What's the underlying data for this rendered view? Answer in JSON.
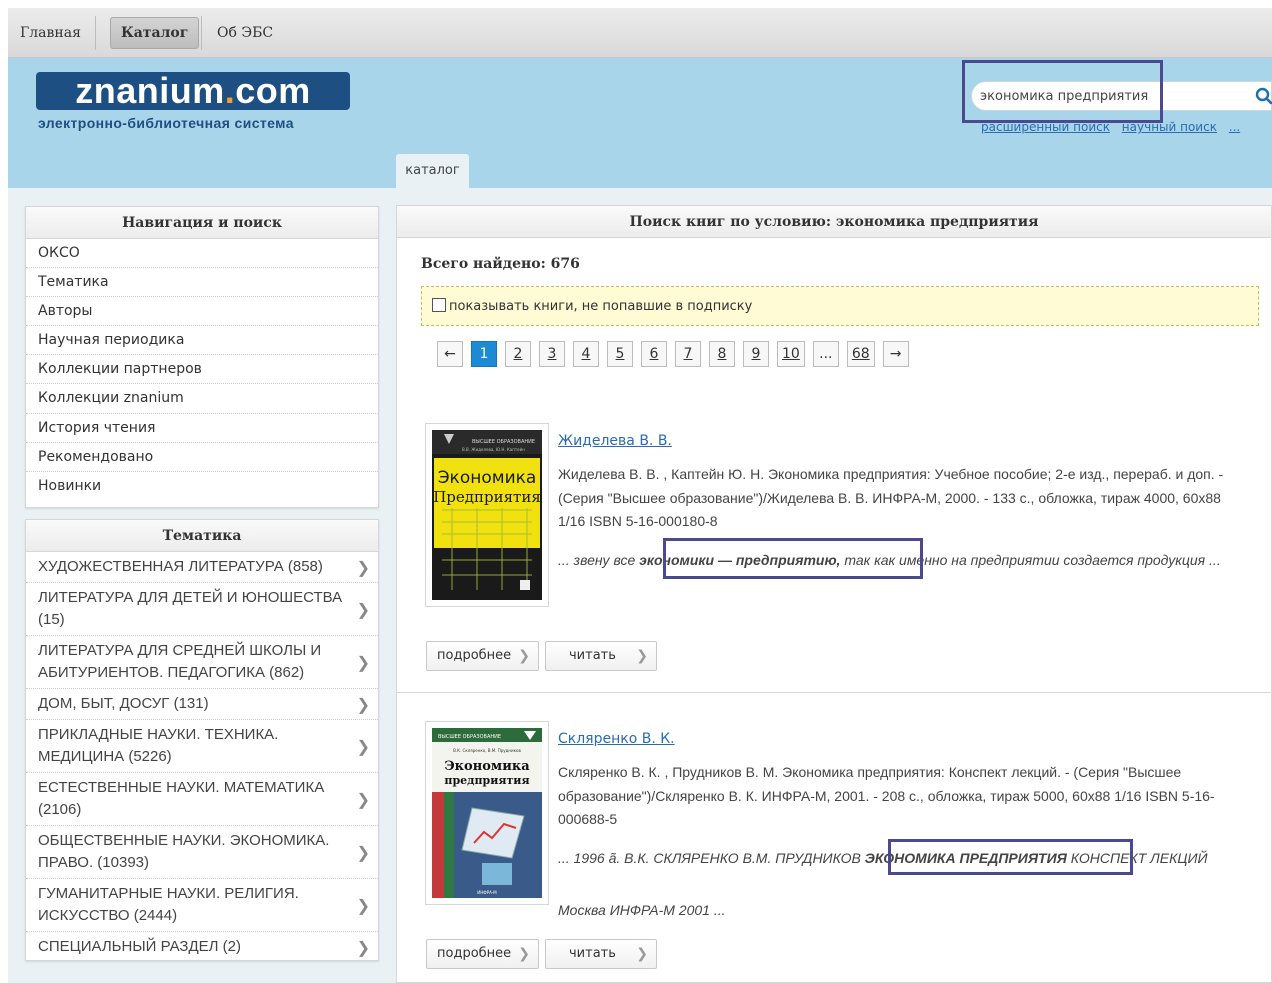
{
  "topnav": {
    "items": [
      "Главная",
      "Каталог",
      "Об ЭБС"
    ],
    "active": 1
  },
  "logo": {
    "main_a": "znanium",
    "dot": ".",
    "main_b": "com",
    "subtitle": "электронно-библиотечная система"
  },
  "search": {
    "value": "экономика предприятия",
    "links": [
      "расширенный поиск",
      "научный поиск",
      "..."
    ]
  },
  "catalog_tab": "каталог",
  "nav_panel": {
    "title": "Навигация и поиск",
    "items": [
      "ОКСО",
      "Тематика",
      "Авторы",
      "Научная периодика",
      "Коллекции партнеров",
      "Коллекции znanium",
      "История чтения",
      "Рекомендовано",
      "Новинки"
    ]
  },
  "theme_panel": {
    "title": "Тематика",
    "items": [
      "ХУДОЖЕСТВЕННАЯ ЛИТЕРАТУРА (858)",
      "ЛИТЕРАТУРА ДЛЯ ДЕТЕЙ И ЮНОШЕСТВА (15)",
      "ЛИТЕРАТУРА ДЛЯ СРЕДНЕЙ ШКОЛЫ И АБИТУРИЕНТОВ. ПЕДАГОГИКА (862)",
      "ДОМ, БЫТ, ДОСУГ (131)",
      "ПРИКЛАДНЫЕ НАУКИ. ТЕХНИКА. МЕДИЦИНА (5226)",
      "ЕСТЕСТВЕННЫЕ НАУКИ. МАТЕМАТИКА (2106)",
      "ОБЩЕСТВЕННЫЕ НАУКИ. ЭКОНОМИКА. ПРАВО. (10393)",
      "ГУМАНИТАРНЫЕ НАУКИ. РЕЛИГИЯ. ИСКУССТВО (2444)",
      "СПЕЦИАЛЬНЫЙ РАЗДЕЛ (2)"
    ]
  },
  "results": {
    "title": "Поиск книг по условию: экономика предприятия",
    "total": "Всего найдено: 676",
    "filter_label": "показывать книги, не попавшие в подписку",
    "pager": [
      "←",
      "1",
      "2",
      "3",
      "4",
      "5",
      "6",
      "7",
      "8",
      "9",
      "10",
      "...",
      "68",
      "→"
    ],
    "btn_more": "подробнее",
    "btn_read": "читать",
    "books": [
      {
        "author": "Жиделева В. В.",
        "desc": "Жиделева В. В. , Каптейн Ю. Н. Экономика предприятия: Учебное пособие; 2-е изд., перераб. и доп. - (Серия \"Высшее образование\")/Жиделева В. В. ИНФРА-М, 2000. - 133 с., обложка, тираж 4000, 60x88 1/16 ISBN 5-16-000180-8",
        "snip_pre": "... звену все",
        "snip_hl": "экономики — предприятию,",
        "snip_post": "так как именно на предприятии создается продукция ...",
        "cover_top": "ВЫСШЕЕ ОБРАЗОВАНИЕ",
        "cover_authors": "В.В. Жиделева, Ю.Н. Каптейн",
        "cover_title_a": "Экономика",
        "cover_title_b": "Предприятия"
      },
      {
        "author": "Скляренко В. К.",
        "desc": "Скляренко В. К. , Прудников В. М. Экономика предприятия: Конспект лекций. - (Серия \"Высшее образование\")/Скляренко В. К. ИНФРА-М, 2001. - 208 с., обложка, тираж 5000, 60x88 1/16 ISBN 5-16-000688-5",
        "snip_pre": "... 1996 ã. В.К. СКЛЯРЕНКО В.М. ПРУДНИКОВ",
        "snip_hl": "ЭКОНОМИКА ПРЕДПРИЯТИЯ",
        "snip_post": "КОНСПЕКТ ЛЕКЦИЙ Москва ИНФРА-М 2001 ...",
        "cover_top": "ВЫСШЕЕ ОБРАЗОВАНИЕ",
        "cover_authors": "В.К. Скляренко, В.М. Прудников",
        "cover_title_a": "Экономика",
        "cover_title_b": "предприятия"
      }
    ]
  }
}
